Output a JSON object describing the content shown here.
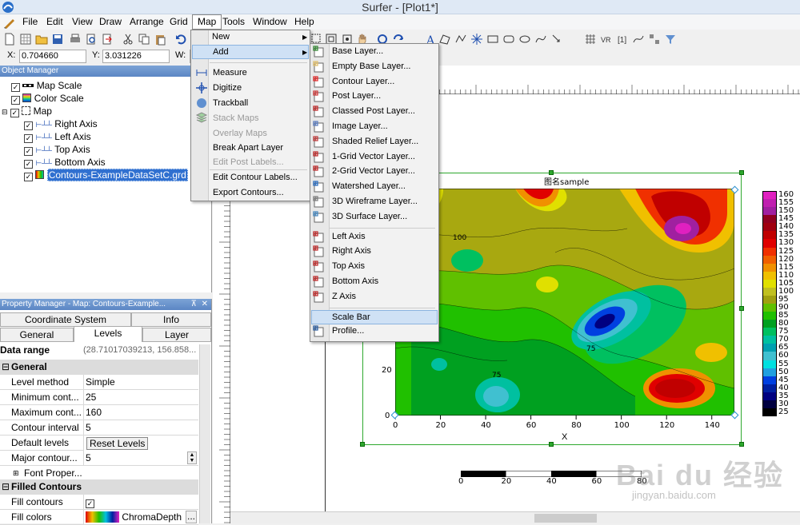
{
  "app": {
    "title": "Surfer - [Plot1*]"
  },
  "menubar": [
    "File",
    "Edit",
    "View",
    "Draw",
    "Arrange",
    "Grid",
    "Map",
    "Tools",
    "Window",
    "Help"
  ],
  "coords": {
    "x_label": "X:",
    "x_value": "0.704660",
    "y_label": "Y:",
    "y_value": "3.031226",
    "w_label": "W:"
  },
  "object_manager": {
    "title": "Object Manager",
    "items": [
      "Map Scale",
      "Color Scale",
      "Map",
      "Right Axis",
      "Left Axis",
      "Top Axis",
      "Bottom Axis",
      "Contours-ExampleDataSetC.grd"
    ]
  },
  "property_manager": {
    "title": "Property Manager - Map: Contours-Example...",
    "tabs_row1": [
      "Coordinate System",
      "Info"
    ],
    "tabs_row2": [
      "General",
      "Levels",
      "Layer"
    ],
    "data_range_label": "Data range",
    "data_range_value": "(28.71017039213, 156.858...",
    "section_general": "General",
    "rows": [
      {
        "k": "Level method",
        "v": "Simple"
      },
      {
        "k": "Minimum cont...",
        "v": "25"
      },
      {
        "k": "Maximum cont...",
        "v": "160"
      },
      {
        "k": "Contour interval",
        "v": "5"
      },
      {
        "k": "Default levels",
        "v": "Reset Levels"
      },
      {
        "k": "Major contour...",
        "v": "5"
      },
      {
        "k": "Font Proper...",
        "v": ""
      }
    ],
    "section_filled": "Filled Contours",
    "fill_contours_label": "Fill contours",
    "fill_colors_label": "Fill colors",
    "fill_colors_value": "ChromaDepth"
  },
  "map_menu": {
    "items": [
      "New",
      "Add",
      "Measure",
      "Digitize",
      "Trackball",
      "Stack Maps",
      "Overlay Maps",
      "Break Apart Layer",
      "Edit Post Labels...",
      "Edit Contour Labels...",
      "Export Contours..."
    ]
  },
  "add_menu": {
    "items": [
      "Base Layer...",
      "Empty Base Layer...",
      "Contour Layer...",
      "Post Layer...",
      "Classed Post Layer...",
      "Image Layer...",
      "Shaded Relief Layer...",
      "1-Grid Vector Layer...",
      "2-Grid Vector Layer...",
      "Watershed Layer...",
      "3D Wireframe Layer...",
      "3D Surface Layer...",
      "Left Axis",
      "Right Axis",
      "Top Axis",
      "Bottom Axis",
      "Z Axis",
      "Scale Bar",
      "Profile..."
    ]
  },
  "plot": {
    "map_title": "图名sample",
    "x_axis_label": "X",
    "x_ticks": [
      "0",
      "20",
      "40",
      "60",
      "80",
      "100",
      "120",
      "140"
    ],
    "y_ticks": [
      "0",
      "20"
    ],
    "contour_labels": [
      "100",
      "75",
      "100"
    ],
    "scale_bar_ticks": [
      "0",
      "20",
      "40",
      "60",
      "80"
    ],
    "color_scale": [
      {
        "v": "160",
        "c": "#e020c0"
      },
      {
        "v": "155",
        "c": "#c020b0"
      },
      {
        "v": "150",
        "c": "#a020a0"
      },
      {
        "v": "145",
        "c": "#900020"
      },
      {
        "v": "140",
        "c": "#a00010"
      },
      {
        "v": "135",
        "c": "#c00000"
      },
      {
        "v": "130",
        "c": "#e00000"
      },
      {
        "v": "125",
        "c": "#f03000"
      },
      {
        "v": "120",
        "c": "#f06000"
      },
      {
        "v": "115",
        "c": "#f09000"
      },
      {
        "v": "110",
        "c": "#f0c000"
      },
      {
        "v": "105",
        "c": "#e0e000"
      },
      {
        "v": "100",
        "c": "#c0c020"
      },
      {
        "v": "95",
        "c": "#a0a010"
      },
      {
        "v": "90",
        "c": "#60c000"
      },
      {
        "v": "85",
        "c": "#20c000"
      },
      {
        "v": "80",
        "c": "#00a020"
      },
      {
        "v": "75",
        "c": "#00c060"
      },
      {
        "v": "70",
        "c": "#00c0a0"
      },
      {
        "v": "65",
        "c": "#00a0b0"
      },
      {
        "v": "60",
        "c": "#40c0d0"
      },
      {
        "v": "55",
        "c": "#00e0e0"
      },
      {
        "v": "50",
        "c": "#20a0e0"
      },
      {
        "v": "45",
        "c": "#0040e0"
      },
      {
        "v": "40",
        "c": "#0020a0"
      },
      {
        "v": "35",
        "c": "#000080"
      },
      {
        "v": "30",
        "c": "#000040"
      },
      {
        "v": "25",
        "c": "#000000"
      }
    ]
  },
  "watermark": {
    "text": "Bai du 经验",
    "url": "jingyan.baidu.com"
  }
}
